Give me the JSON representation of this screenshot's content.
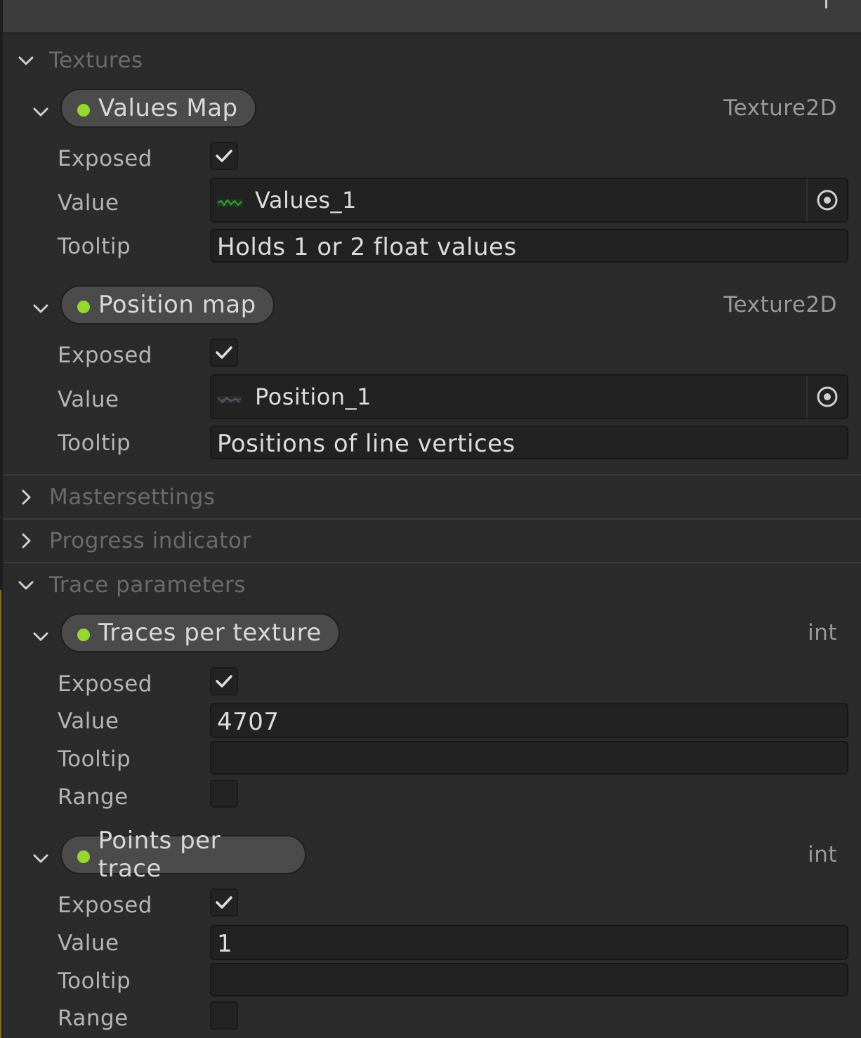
{
  "sections": {
    "textures": {
      "title": "Textures",
      "expanded": true
    },
    "mastersettings": {
      "title": "Mastersettings",
      "expanded": false
    },
    "progress_indicator": {
      "title": "Progress indicator",
      "expanded": false
    },
    "trace_parameters": {
      "title": "Trace parameters",
      "expanded": true
    }
  },
  "labels": {
    "exposed": "Exposed",
    "value": "Value",
    "tooltip": "Tooltip",
    "range": "Range"
  },
  "properties": {
    "values_map": {
      "name": "Values Map",
      "type": "Texture2D",
      "exposed": true,
      "value": "Values_1",
      "tooltip": "Holds 1 or 2 float values"
    },
    "position_map": {
      "name": "Position map",
      "type": "Texture2D",
      "exposed": true,
      "value": "Position_1",
      "tooltip": "Positions of line vertices"
    },
    "traces_per_texture": {
      "name": "Traces per texture",
      "type": "int",
      "exposed": true,
      "value": "4707",
      "tooltip": "",
      "range": false
    },
    "points_per_trace": {
      "name": "Points per trace",
      "type": "int",
      "exposed": true,
      "value": "1",
      "tooltip": "",
      "range": false
    }
  },
  "colors": {
    "background": "#2b2b2b",
    "exposed_dot": "#95d830",
    "field_background": "#222222",
    "header_text": "#6b6b6b"
  },
  "icons": {
    "section_expanded": "chevron-down-icon",
    "section_collapsed": "chevron-right-icon",
    "checked": "checkmark-icon",
    "object_picker": "object-picker-icon"
  }
}
